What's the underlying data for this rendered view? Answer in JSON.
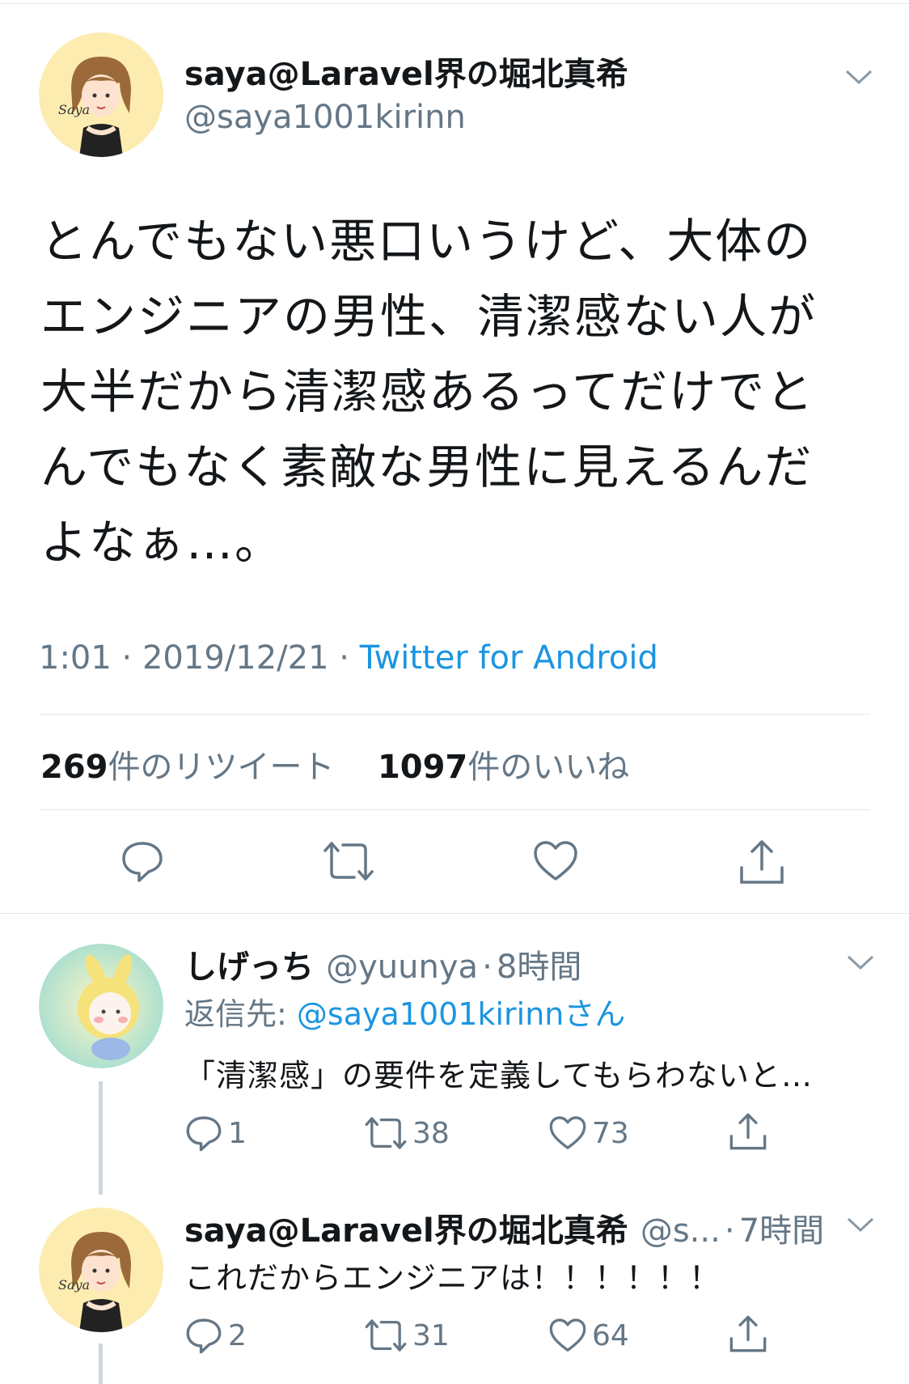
{
  "main_tweet": {
    "display_name": "saya@Laravel界の堀北真希",
    "handle": "@saya1001kirinn",
    "text": "とんでもない悪口いうけど、大体のエンジニアの男性、清潔感ない人が大半だから清潔感あるってだけでとんでもなく素敵な男性に見えるんだよなぁ…。",
    "time": "1:01",
    "date": "2019/12/21",
    "sep": "·",
    "source": "Twitter for Android",
    "retweet_count": "269",
    "retweet_label": "件のリツイート",
    "like_count": "1097",
    "like_label": "件のいいね",
    "avatar_text": "Saya"
  },
  "reply1": {
    "display_name": "しげっち",
    "handle": "@yuunya",
    "sep": "·",
    "time": "8時間",
    "reply_to_label": "返信先:",
    "reply_to_user": "@saya1001kirinnさん",
    "text": "「清潔感」の要件を定義してもらわないと…",
    "reply_count": "1",
    "retweet_count": "38",
    "like_count": "73"
  },
  "reply2": {
    "display_name": "saya@Laravel界の堀北真希",
    "handle": "@s...",
    "sep": "·",
    "time": "7時間",
    "text": "これだからエンジニアは！！！！！！",
    "reply_count": "2",
    "retweet_count": "31",
    "like_count": "64",
    "avatar_text": "Saya"
  },
  "colors": {
    "link": "#1b95e0",
    "muted": "#657786",
    "divider": "#e1e8ed",
    "avatar_bg": "#fdecb0"
  }
}
